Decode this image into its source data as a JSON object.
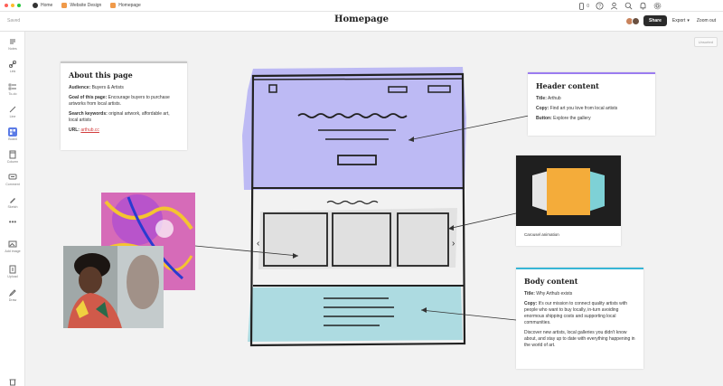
{
  "app_bar": {
    "home_label": "Home",
    "tab1": "Website Design",
    "tab2": "Homepage"
  },
  "header": {
    "saved": "Saved",
    "title": "Homepage",
    "share": "Share",
    "export": "Export",
    "zoom": "Zoom out",
    "count": "0"
  },
  "tools": [
    {
      "label": "Notes"
    },
    {
      "label": "Link"
    },
    {
      "label": "To-do"
    },
    {
      "label": "Line"
    },
    {
      "label": "Board"
    },
    {
      "label": "Column"
    },
    {
      "label": "Comment"
    },
    {
      "label": "Sketch"
    },
    {
      "label": "Add image"
    },
    {
      "label": "Upload"
    },
    {
      "label": "Draw"
    }
  ],
  "unsorted": "Unsorted",
  "about": {
    "title": "About this page",
    "audience_label": "Audience:",
    "audience": "Buyers & Artists",
    "goal_label": "Goal of this page:",
    "goal": "Encourage buyers to purchase artworks from local artists.",
    "keywords_label": "Search keywords:",
    "keywords": "original artwork, affordable art, local artists",
    "url_label": "URL:",
    "url": "arthub.cc"
  },
  "header_content": {
    "title": "Header content",
    "title_label": "Title:",
    "title_value": "Arthub",
    "copy_label": "Copy:",
    "copy_value": "Find art you love from local artists",
    "button_label": "Button:",
    "button_value": "Explore the gallery"
  },
  "carousel": {
    "caption": "Carousel animation"
  },
  "body_content": {
    "title": "Body content",
    "title_label": "Title:",
    "title_value": "Why Arthub exists",
    "copy_label": "Copy:",
    "copy_value": "It's our mission to connect quality artists with people who want to buy locally, in-turn avoiding enormous shipping costs and supporting local communities.",
    "copy2": "Discover new artists, local galleries you didn't know about, and stay up to date with everything happening in the world of art."
  },
  "colors": {
    "header_fill": "#b9b6f3",
    "body_fill": "#a9d9df",
    "header_accent": "#9b7cf0",
    "body_accent": "#37b6d6",
    "about_accent": "#c7c7c7"
  }
}
